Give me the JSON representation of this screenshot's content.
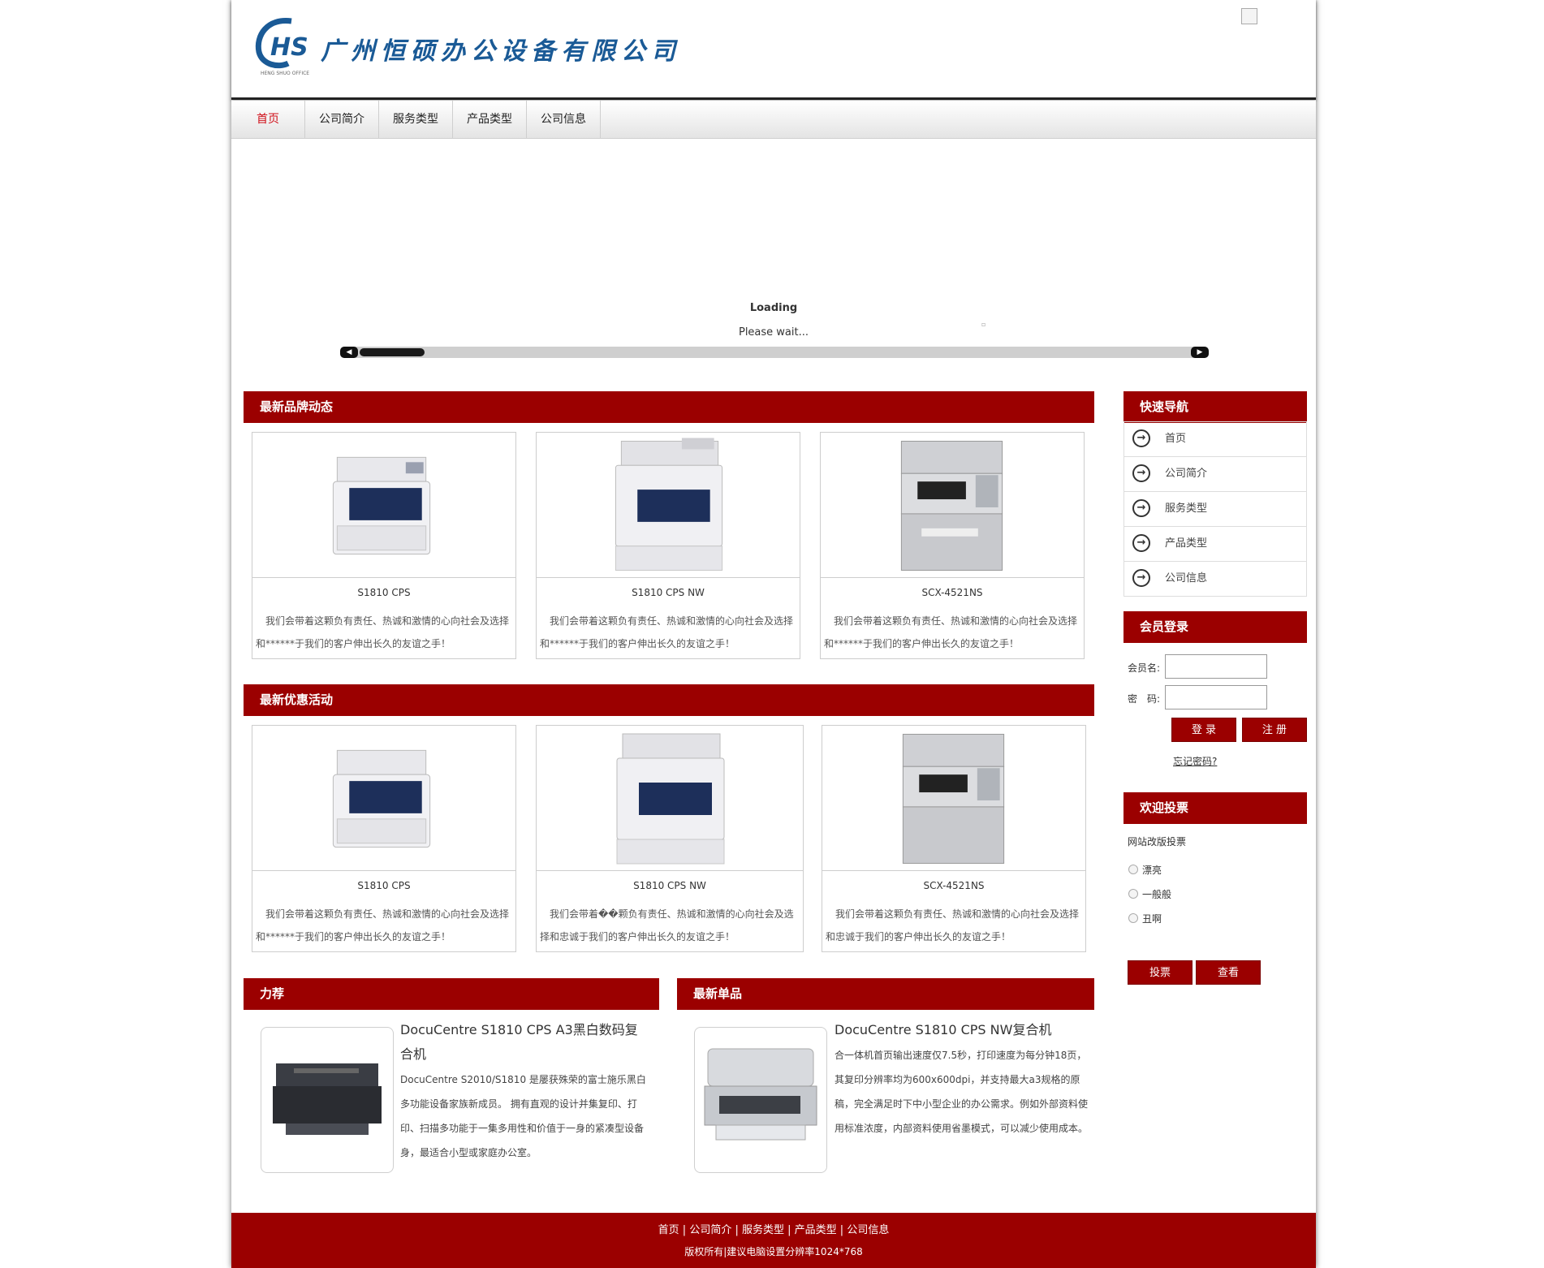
{
  "header": {
    "logo_text": "HS",
    "logo_subtext": "HENG SHUO OFFICE",
    "company_name": "广州恒硕办公设备有限公司"
  },
  "nav": [
    "首页",
    "公司简介",
    "服务类型",
    "产品类型",
    "公司信息"
  ],
  "banner": {
    "loading": "Loading",
    "please_wait": "Please wait...",
    "scroll_left": "◀",
    "scroll_right": "▶",
    "dot": "▫"
  },
  "sections": {
    "brand_news": "最新品牌动态",
    "promotions": "最新优惠活动",
    "recommend": "力荐",
    "new_items": "最新单品",
    "quick_nav": "快速导航",
    "member_login": "会员登录",
    "vote": "欢迎投票"
  },
  "brand_news": [
    {
      "name": "S1810 CPS",
      "desc": "我们会带着这颗负有责任、热诚和激情的心向社会及选择和******于我们的客户伸出长久的友谊之手！"
    },
    {
      "name": "S1810 CPS NW",
      "desc": "我们会带着这颗负有责任、热诚和激情的心向社会及选择和******于我们的客户伸出长久的友谊之手！"
    },
    {
      "name": "SCX-4521NS",
      "desc": "我们会带着这颗负有责任、热诚和激情的心向社会及选择和******于我们的客户伸出长久的友谊之手！"
    }
  ],
  "promotions": [
    {
      "name": "S1810 CPS",
      "desc": "我们会带着这颗负有责任、热诚和激情的心向社会及选择和******于我们的客户伸出长久的友谊之手！"
    },
    {
      "name": "S1810 CPS NW",
      "desc": "我们会带着��颗负有责任、热诚和激情的心向社会及选择和忠诚于我们的客户伸出长久的友谊之手！"
    },
    {
      "name": "SCX-4521NS",
      "desc": "我们会带着这颗负有责任、热诚和激情的心向社会及选择和忠诚于我们的客户伸出长久的友谊之手！"
    }
  ],
  "quick_nav": [
    "首页",
    "公司简介",
    "服务类型",
    "产品类型",
    "公司信息"
  ],
  "quick_nav_icon": "arrow-right-circle-icon",
  "login": {
    "username_label": "会员名:",
    "password_label": "密　码:",
    "login_button": "登 录",
    "register_button": "注 册",
    "forgot": "忘记密码?"
  },
  "vote": {
    "question": "网站改版投票",
    "options": [
      "漂亮",
      "一般般",
      "丑啊"
    ],
    "vote_button": "投票",
    "view_button": "查看"
  },
  "recommend": {
    "title": "DocuCentre S1810 CPS A3黑白数码复合机",
    "desc": "DocuCentre S2010/S1810 是屡获殊荣的富士施乐黑白多功能设备家族新成员。 拥有直观的设计并集复印、打印、扫描多功能于一集多用性和价值于一身的紧凑型设备身，最适合小型或家庭办公室。"
  },
  "new_item": {
    "title": "DocuCentre S1810 CPS NW复合机",
    "desc": "合一体机首页输出速度仅7.5秒，打印速度为每分钟18页，其复印分辨率均为600x600dpi，并支持最大a3规格的原稿，完全满足时下中小型企业的办公需求。例如外部资料使用标准浓度，内部资料使用省墨模式，可以减少使用成本。"
  },
  "footer": {
    "links": [
      "首页",
      "公司简介",
      "服务类型",
      "产品类型",
      "公司信息"
    ],
    "sep": " | ",
    "copyright": "版权所有|建议电脑设置分辨率1024*768"
  },
  "colors": {
    "brand_red": "#9b0000",
    "logo_blue": "#1a5a96",
    "nav_active": "#d0101a"
  }
}
